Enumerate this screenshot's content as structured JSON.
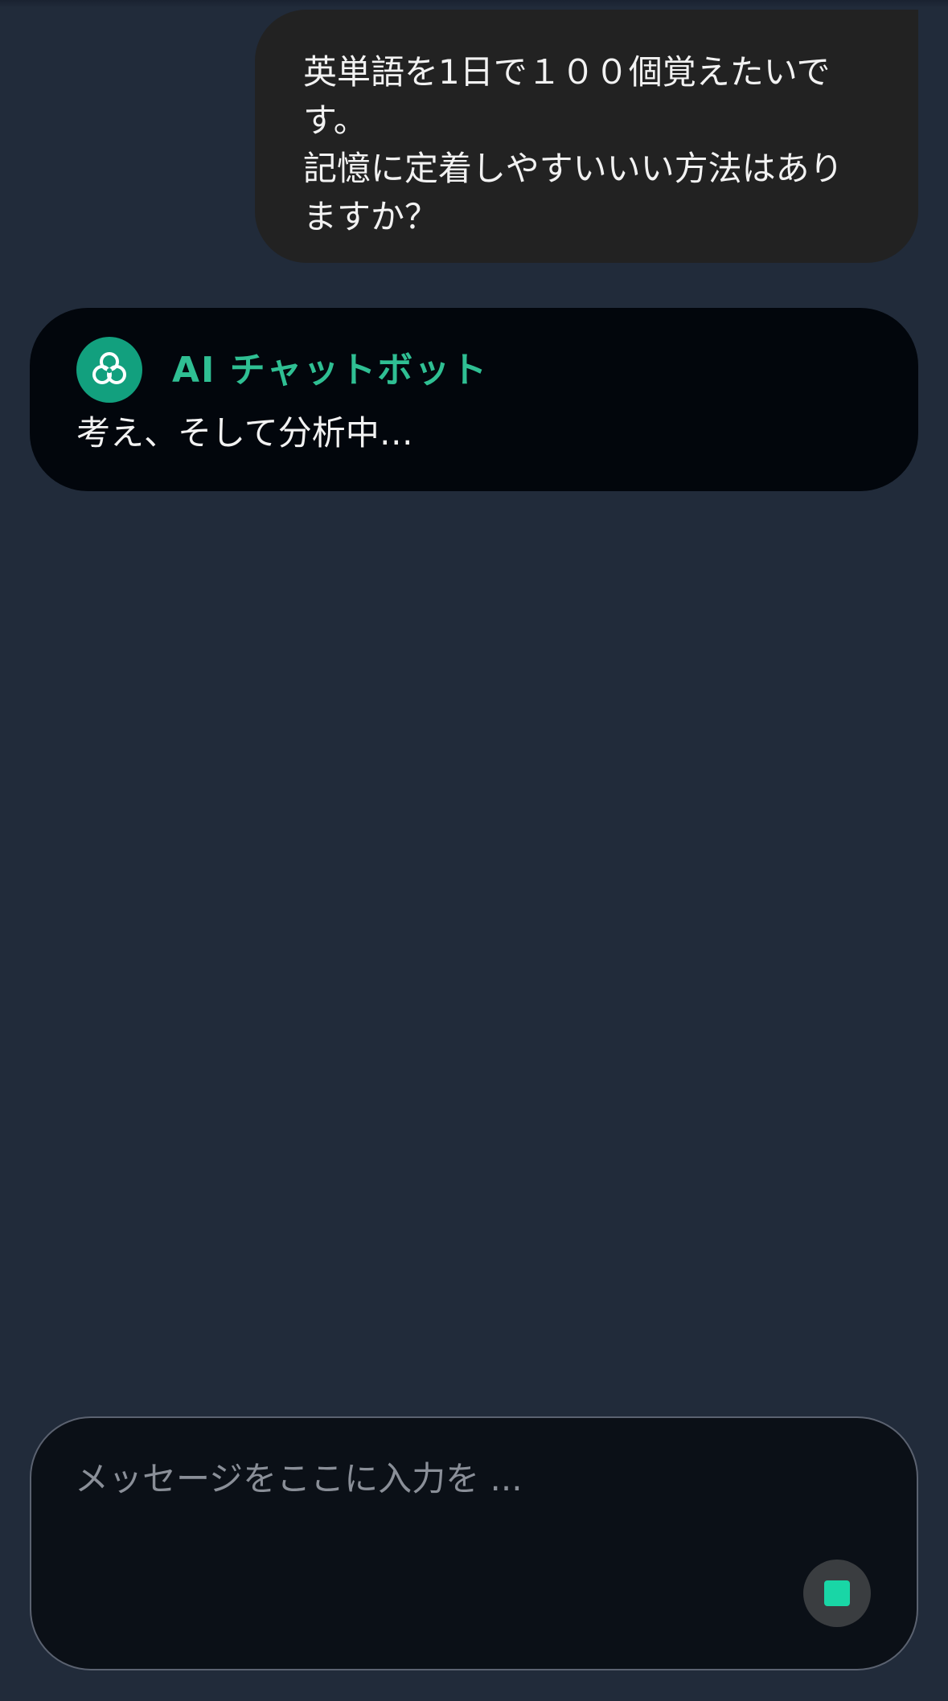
{
  "conversation": {
    "user_message": "英単語を1日で１００個覚えたいで\nす。\n記憶に定着しやすいいい方法はあり\nますか？",
    "bot": {
      "name": "AI チャットボット",
      "avatar_icon": "knot-logo-icon",
      "status_text": "考え、そして分析中…"
    }
  },
  "composer": {
    "placeholder": "メッセージをここに入力を ...",
    "value": "",
    "stop_icon": "stop-square-icon"
  },
  "colors": {
    "background": "#212b3a",
    "accent": "#19d6a6",
    "bot_name": "#2fbf93",
    "avatar": "#12a07e"
  }
}
